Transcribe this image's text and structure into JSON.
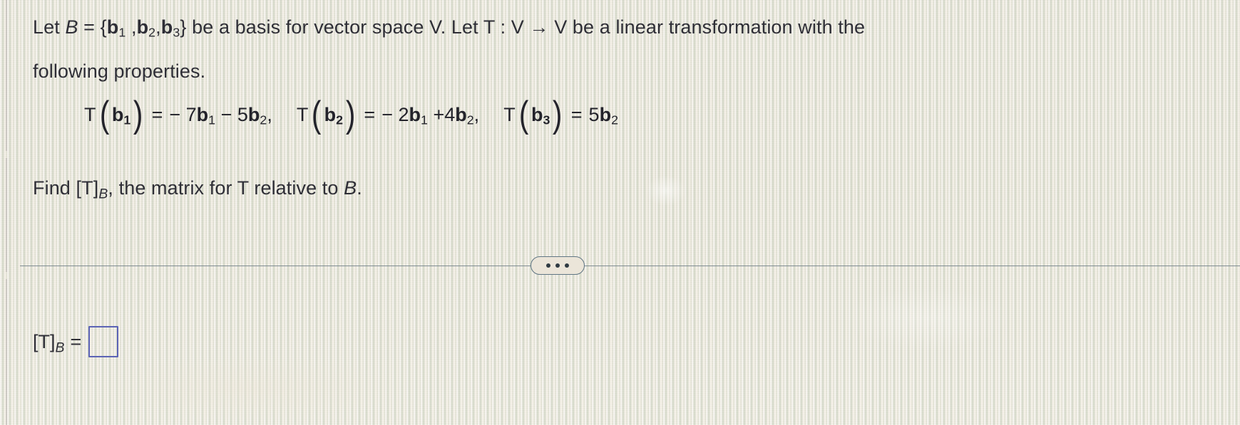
{
  "problem": {
    "intro_line_1_a": "Let ",
    "intro_basis_symbol": "B",
    "intro_line_1_b": " = {",
    "basis_vector_1": "b",
    "basis_vector_1_index": "1",
    "basis_sep_1": " ,",
    "basis_vector_2": "b",
    "basis_vector_2_index": "2",
    "basis_sep_2": ",",
    "basis_vector_3": "b",
    "basis_vector_3_index": "3",
    "intro_line_1_c": "} be a basis for vector space V. Let T : V ",
    "arrow": "→",
    "intro_line_1_d": " V be a linear transformation with the",
    "intro_line_2": "following properties.",
    "find_prefix": "Find [T]",
    "find_subscript": "B",
    "find_suffix": ", the matrix for T relative to ",
    "find_basis_symbol": "B",
    "find_period": "."
  },
  "equations": [
    {
      "function_name": "T",
      "open_paren": "(",
      "arg_letter": "b",
      "arg_index": "1",
      "close_paren": ")",
      "relation": "=",
      "rhs": "− 7b₁ − 5b₂",
      "rhs_parts": [
        {
          "sign": "− ",
          "coefficient": "7",
          "vector": "b",
          "index": "1"
        },
        {
          "sign": " − ",
          "coefficient": "5",
          "vector": "b",
          "index": "2"
        }
      ],
      "trailing_separator": ","
    },
    {
      "function_name": "T",
      "open_paren": "(",
      "arg_letter": "b",
      "arg_index": "2",
      "close_paren": ")",
      "relation": "=",
      "rhs": "− 2b₁ + 4b₂",
      "rhs_parts": [
        {
          "sign": "− ",
          "coefficient": "2",
          "vector": "b",
          "index": "1"
        },
        {
          "sign": " +",
          "coefficient": "4",
          "vector": "b",
          "index": "2"
        }
      ],
      "trailing_separator": ","
    },
    {
      "function_name": "T",
      "open_paren": "(",
      "arg_letter": "b",
      "arg_index": "3",
      "close_paren": ")",
      "relation": "=",
      "rhs": "5b₂",
      "rhs_parts": [
        {
          "sign": "",
          "coefficient": "5",
          "vector": "b",
          "index": "2"
        }
      ],
      "trailing_separator": ""
    }
  ],
  "divider": {
    "more_options_label": "•••",
    "dot_count": 3
  },
  "answer": {
    "label_prefix": "[T]",
    "label_subscript": "B",
    "equals": "=",
    "input_value": "",
    "input_placeholder": ""
  },
  "colors": {
    "paper": "#e7e1d4",
    "text": "#2e2e36",
    "divider": "#6d7d86",
    "input_border": "#5b63b5"
  }
}
